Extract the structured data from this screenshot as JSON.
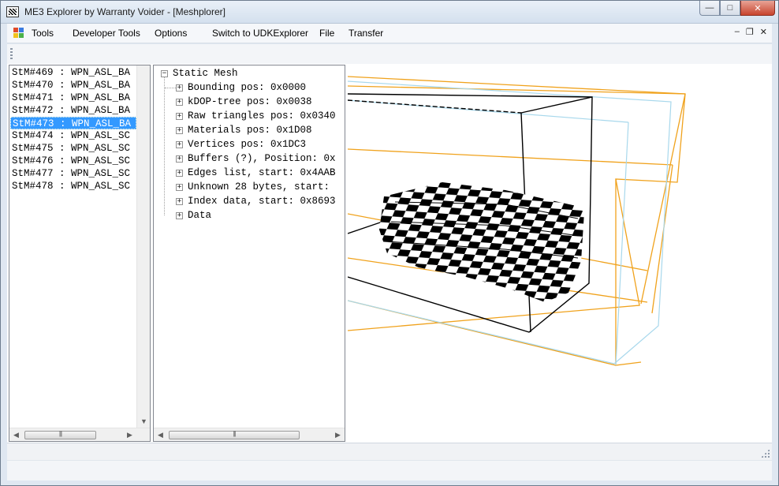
{
  "window": {
    "title": "ME3 Explorer by Warranty Voider - [Meshplorer]",
    "minimize_glyph": "—",
    "maximize_glyph": "□",
    "close_glyph": "✕"
  },
  "menu": {
    "items": [
      "Tools",
      "Developer Tools",
      "Options",
      "Switch to UDKExplorer",
      "File",
      "Transfer"
    ],
    "mdi_minimize_glyph": "–",
    "mdi_restore_glyph": "❐",
    "mdi_close_glyph": "✕"
  },
  "mesh_list": {
    "items": [
      "StM#469 : WPN_ASL_BA",
      "StM#470 : WPN_ASL_BA",
      "StM#471 : WPN_ASL_BA",
      "StM#472 : WPN_ASL_BA",
      "StM#473 : WPN_ASL_BA",
      "StM#474 : WPN_ASL_SC",
      "StM#475 : WPN_ASL_SC",
      "StM#476 : WPN_ASL_SC",
      "StM#477 : WPN_ASL_SC",
      "StM#478 : WPN_ASL_SC"
    ],
    "selected_index": 4
  },
  "tree": {
    "root": "Static Mesh",
    "root_expander": "−",
    "child_expander": "+",
    "children": [
      "Bounding pos: 0x0000",
      "kDOP-tree pos: 0x0038",
      "Raw triangles pos: 0x0340",
      "Materials pos: 0x1D08",
      "Vertices pos: 0x1DC3",
      "Buffers (?), Position: 0x",
      "Edges list, start: 0x4AAB",
      "Unknown 28 bytes, start: ",
      "Index data, start: 0x8693",
      "Data"
    ]
  },
  "scrollbar": {
    "left_arrow": "◀",
    "right_arrow": "▶",
    "down_arrow": "▼"
  },
  "colors": {
    "selection": "#3399ff",
    "bounding_box_orange": "#f0a21c",
    "bounding_box_cyan": "#a8d8ec",
    "mesh_checker": "#000000"
  }
}
